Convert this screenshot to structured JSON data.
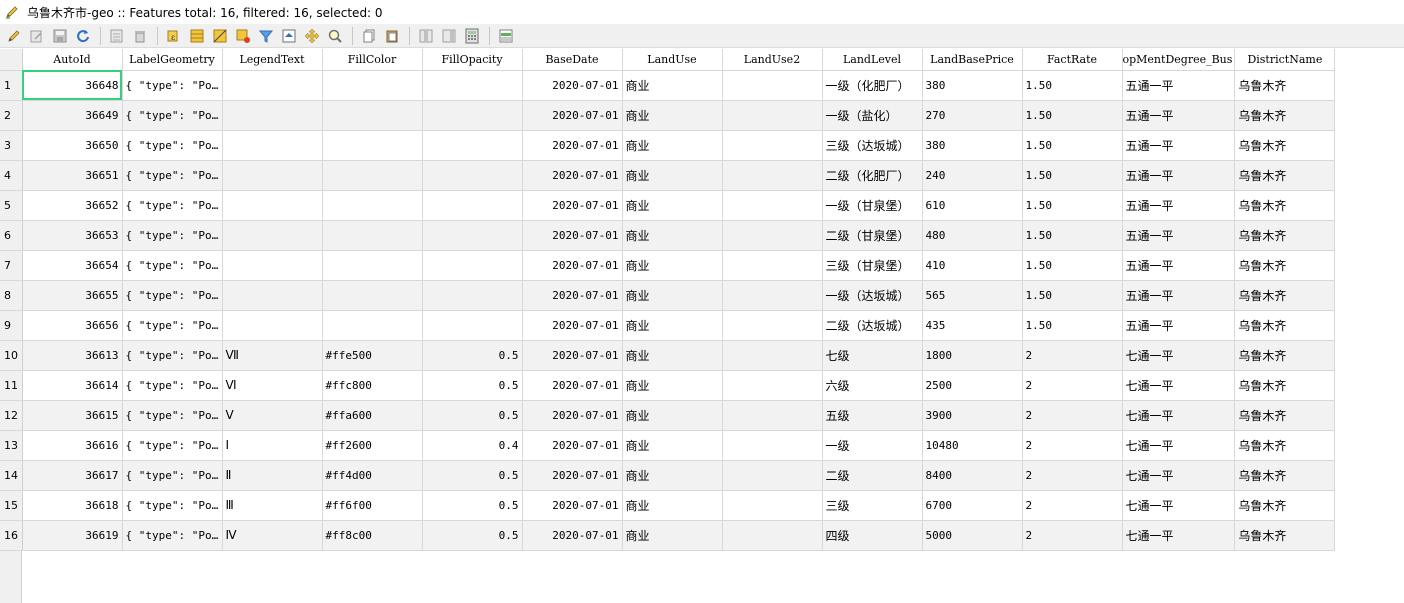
{
  "window": {
    "title": "乌鲁木齐市-geo :: Features total: 16, filtered: 16, selected: 0"
  },
  "toolbar": {
    "buttons": [
      "toggle-editing",
      "multi-edit",
      "save-edits",
      "reload-table",
      "separator",
      "add-feature",
      "delete-feature",
      "separator",
      "select-by-expression",
      "select-all",
      "invert-selection",
      "deselect-all",
      "filter-select",
      "move-selection-to-top",
      "pan-to-selected",
      "zoom-to-selected",
      "separator",
      "copy-rows",
      "paste-features",
      "separator",
      "delete-field",
      "new-field",
      "field-calculator",
      "separator",
      "conditional-formatting"
    ]
  },
  "table": {
    "columns": [
      "AutoId",
      "LabelGeometry",
      "LegendText",
      "FillColor",
      "FillOpacity",
      "BaseDate",
      "LandUse",
      "LandUse2",
      "LandLevel",
      "LandBasePrice",
      "FactRate",
      "opMentDegree_Bus",
      "DistrictName"
    ],
    "rows": [
      {
        "n": "1",
        "AutoId": "36648",
        "LabelGeometry": "{ \"type\": \"Po…",
        "LegendText": "",
        "FillColor": "",
        "FillOpacity": "",
        "BaseDate": "2020-07-01",
        "LandUse": "商业",
        "LandUse2": "",
        "LandLevel": "一级（化肥厂）",
        "LandBasePrice": "380",
        "FactRate": "1.50",
        "Dev": "五通一平",
        "District": "乌鲁木齐"
      },
      {
        "n": "2",
        "AutoId": "36649",
        "LabelGeometry": "{ \"type\": \"Po…",
        "LegendText": "",
        "FillColor": "",
        "FillOpacity": "",
        "BaseDate": "2020-07-01",
        "LandUse": "商业",
        "LandUse2": "",
        "LandLevel": "一级（盐化）",
        "LandBasePrice": "270",
        "FactRate": "1.50",
        "Dev": "五通一平",
        "District": "乌鲁木齐"
      },
      {
        "n": "3",
        "AutoId": "36650",
        "LabelGeometry": "{ \"type\": \"Po…",
        "LegendText": "",
        "FillColor": "",
        "FillOpacity": "",
        "BaseDate": "2020-07-01",
        "LandUse": "商业",
        "LandUse2": "",
        "LandLevel": "三级（达坂城）",
        "LandBasePrice": "380",
        "FactRate": "1.50",
        "Dev": "五通一平",
        "District": "乌鲁木齐"
      },
      {
        "n": "4",
        "AutoId": "36651",
        "LabelGeometry": "{ \"type\": \"Po…",
        "LegendText": "",
        "FillColor": "",
        "FillOpacity": "",
        "BaseDate": "2020-07-01",
        "LandUse": "商业",
        "LandUse2": "",
        "LandLevel": "二级（化肥厂）",
        "LandBasePrice": "240",
        "FactRate": "1.50",
        "Dev": "五通一平",
        "District": "乌鲁木齐"
      },
      {
        "n": "5",
        "AutoId": "36652",
        "LabelGeometry": "{ \"type\": \"Po…",
        "LegendText": "",
        "FillColor": "",
        "FillOpacity": "",
        "BaseDate": "2020-07-01",
        "LandUse": "商业",
        "LandUse2": "",
        "LandLevel": "一级（甘泉堡）",
        "LandBasePrice": "610",
        "FactRate": "1.50",
        "Dev": "五通一平",
        "District": "乌鲁木齐"
      },
      {
        "n": "6",
        "AutoId": "36653",
        "LabelGeometry": "{ \"type\": \"Po…",
        "LegendText": "",
        "FillColor": "",
        "FillOpacity": "",
        "BaseDate": "2020-07-01",
        "LandUse": "商业",
        "LandUse2": "",
        "LandLevel": "二级（甘泉堡）",
        "LandBasePrice": "480",
        "FactRate": "1.50",
        "Dev": "五通一平",
        "District": "乌鲁木齐"
      },
      {
        "n": "7",
        "AutoId": "36654",
        "LabelGeometry": "{ \"type\": \"Po…",
        "LegendText": "",
        "FillColor": "",
        "FillOpacity": "",
        "BaseDate": "2020-07-01",
        "LandUse": "商业",
        "LandUse2": "",
        "LandLevel": "三级（甘泉堡）",
        "LandBasePrice": "410",
        "FactRate": "1.50",
        "Dev": "五通一平",
        "District": "乌鲁木齐"
      },
      {
        "n": "8",
        "AutoId": "36655",
        "LabelGeometry": "{ \"type\": \"Po…",
        "LegendText": "",
        "FillColor": "",
        "FillOpacity": "",
        "BaseDate": "2020-07-01",
        "LandUse": "商业",
        "LandUse2": "",
        "LandLevel": "一级（达坂城）",
        "LandBasePrice": "565",
        "FactRate": "1.50",
        "Dev": "五通一平",
        "District": "乌鲁木齐"
      },
      {
        "n": "9",
        "AutoId": "36656",
        "LabelGeometry": "{ \"type\": \"Po…",
        "LegendText": "",
        "FillColor": "",
        "FillOpacity": "",
        "BaseDate": "2020-07-01",
        "LandUse": "商业",
        "LandUse2": "",
        "LandLevel": "二级（达坂城）",
        "LandBasePrice": "435",
        "FactRate": "1.50",
        "Dev": "五通一平",
        "District": "乌鲁木齐"
      },
      {
        "n": "10",
        "AutoId": "36613",
        "LabelGeometry": "{ \"type\": \"Po…",
        "LegendText": "Ⅶ",
        "FillColor": "#ffe500",
        "FillOpacity": "0.5",
        "BaseDate": "2020-07-01",
        "LandUse": "商业",
        "LandUse2": "",
        "LandLevel": "七级",
        "LandBasePrice": "1800",
        "FactRate": "2",
        "Dev": "七通一平",
        "District": "乌鲁木齐"
      },
      {
        "n": "11",
        "AutoId": "36614",
        "LabelGeometry": "{ \"type\": \"Po…",
        "LegendText": "Ⅵ",
        "FillColor": "#ffc800",
        "FillOpacity": "0.5",
        "BaseDate": "2020-07-01",
        "LandUse": "商业",
        "LandUse2": "",
        "LandLevel": "六级",
        "LandBasePrice": "2500",
        "FactRate": "2",
        "Dev": "七通一平",
        "District": "乌鲁木齐"
      },
      {
        "n": "12",
        "AutoId": "36615",
        "LabelGeometry": "{ \"type\": \"Po…",
        "LegendText": "Ⅴ",
        "FillColor": "#ffa600",
        "FillOpacity": "0.5",
        "BaseDate": "2020-07-01",
        "LandUse": "商业",
        "LandUse2": "",
        "LandLevel": "五级",
        "LandBasePrice": "3900",
        "FactRate": "2",
        "Dev": "七通一平",
        "District": "乌鲁木齐"
      },
      {
        "n": "13",
        "AutoId": "36616",
        "LabelGeometry": "{ \"type\": \"Po…",
        "LegendText": "Ⅰ",
        "FillColor": "#ff2600",
        "FillOpacity": "0.4",
        "BaseDate": "2020-07-01",
        "LandUse": "商业",
        "LandUse2": "",
        "LandLevel": "一级",
        "LandBasePrice": "10480",
        "FactRate": "2",
        "Dev": "七通一平",
        "District": "乌鲁木齐"
      },
      {
        "n": "14",
        "AutoId": "36617",
        "LabelGeometry": "{ \"type\": \"Po…",
        "LegendText": "Ⅱ",
        "FillColor": "#ff4d00",
        "FillOpacity": "0.5",
        "BaseDate": "2020-07-01",
        "LandUse": "商业",
        "LandUse2": "",
        "LandLevel": "二级",
        "LandBasePrice": "8400",
        "FactRate": "2",
        "Dev": "七通一平",
        "District": "乌鲁木齐"
      },
      {
        "n": "15",
        "AutoId": "36618",
        "LabelGeometry": "{ \"type\": \"Po…",
        "LegendText": "Ⅲ",
        "FillColor": "#ff6f00",
        "FillOpacity": "0.5",
        "BaseDate": "2020-07-01",
        "LandUse": "商业",
        "LandUse2": "",
        "LandLevel": "三级",
        "LandBasePrice": "6700",
        "FactRate": "2",
        "Dev": "七通一平",
        "District": "乌鲁木齐"
      },
      {
        "n": "16",
        "AutoId": "36619",
        "LabelGeometry": "{ \"type\": \"Po…",
        "LegendText": "Ⅳ",
        "FillColor": "#ff8c00",
        "FillOpacity": "0.5",
        "BaseDate": "2020-07-01",
        "LandUse": "商业",
        "LandUse2": "",
        "LandLevel": "四级",
        "LandBasePrice": "5000",
        "FactRate": "2",
        "Dev": "七通一平",
        "District": "乌鲁木齐"
      }
    ]
  }
}
